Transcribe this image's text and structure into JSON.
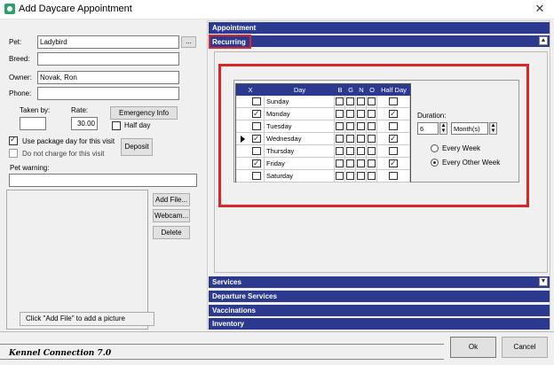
{
  "window": {
    "title": "Add Daycare Appointment",
    "close_glyph": "✕"
  },
  "pet_form": {
    "pet_label": "Pet:",
    "pet_value": "Ladybird",
    "pet_browse": "...",
    "breed_label": "Breed:",
    "breed_value": "",
    "owner_label": "Owner:",
    "owner_value": "Novak, Ron",
    "phone_label": "Phone:",
    "phone_value": "",
    "taken_by_label": "Taken by:",
    "taken_by_value": "",
    "rate_label": "Rate:",
    "rate_value": "30.00",
    "emergency_button": "Emergency Info",
    "half_day_label": "Half day",
    "half_day_checked": false,
    "use_package_label": "Use package day for this visit",
    "use_package_checked": true,
    "no_charge_label": "Do not charge for this visit",
    "no_charge_checked": false,
    "deposit_button": "Deposit",
    "pet_warning_label": "Pet warning:",
    "pet_warning_value": ""
  },
  "picture": {
    "add_file_button": "Add File...",
    "webcam_button": "Webcam...",
    "delete_button": "Delete",
    "hint": "Click \"Add File\" to add a picture"
  },
  "sections": {
    "appointment": "Appointment",
    "recurring": "Recurring",
    "services": "Services",
    "departure_services": "Departure Services",
    "vaccinations": "Vaccinations",
    "inventory": "Inventory"
  },
  "recurring": {
    "columns": [
      "X",
      "Day",
      "B",
      "G",
      "N",
      "O",
      "Half Day"
    ],
    "rows": [
      {
        "day": "Sunday",
        "x": false,
        "b": false,
        "g": false,
        "n": false,
        "o": false,
        "half": false,
        "current": false
      },
      {
        "day": "Monday",
        "x": true,
        "b": false,
        "g": false,
        "n": false,
        "o": false,
        "half": true,
        "current": false
      },
      {
        "day": "Tuesday",
        "x": false,
        "b": false,
        "g": false,
        "n": false,
        "o": false,
        "half": false,
        "current": false
      },
      {
        "day": "Wednesday",
        "x": true,
        "b": false,
        "g": false,
        "n": false,
        "o": false,
        "half": true,
        "current": true
      },
      {
        "day": "Thursday",
        "x": false,
        "b": false,
        "g": false,
        "n": false,
        "o": false,
        "half": false,
        "current": false
      },
      {
        "day": "Friday",
        "x": true,
        "b": false,
        "g": false,
        "n": false,
        "o": false,
        "half": true,
        "current": false
      },
      {
        "day": "Saturday",
        "x": false,
        "b": false,
        "g": false,
        "n": false,
        "o": false,
        "half": false,
        "current": false
      }
    ],
    "duration_label": "Duration:",
    "duration_value": "6",
    "duration_unit": "Month(s)",
    "every_week_label": "Every Week",
    "every_other_week_label": "Every Other Week",
    "selected_frequency": "every_other_week"
  },
  "footer": {
    "brand": "Kennel Connection 7.0",
    "ok_button": "Ok",
    "cancel_button": "Cancel"
  },
  "colors": {
    "section_header": "#2b3a8f",
    "highlight": "#d9262c"
  }
}
